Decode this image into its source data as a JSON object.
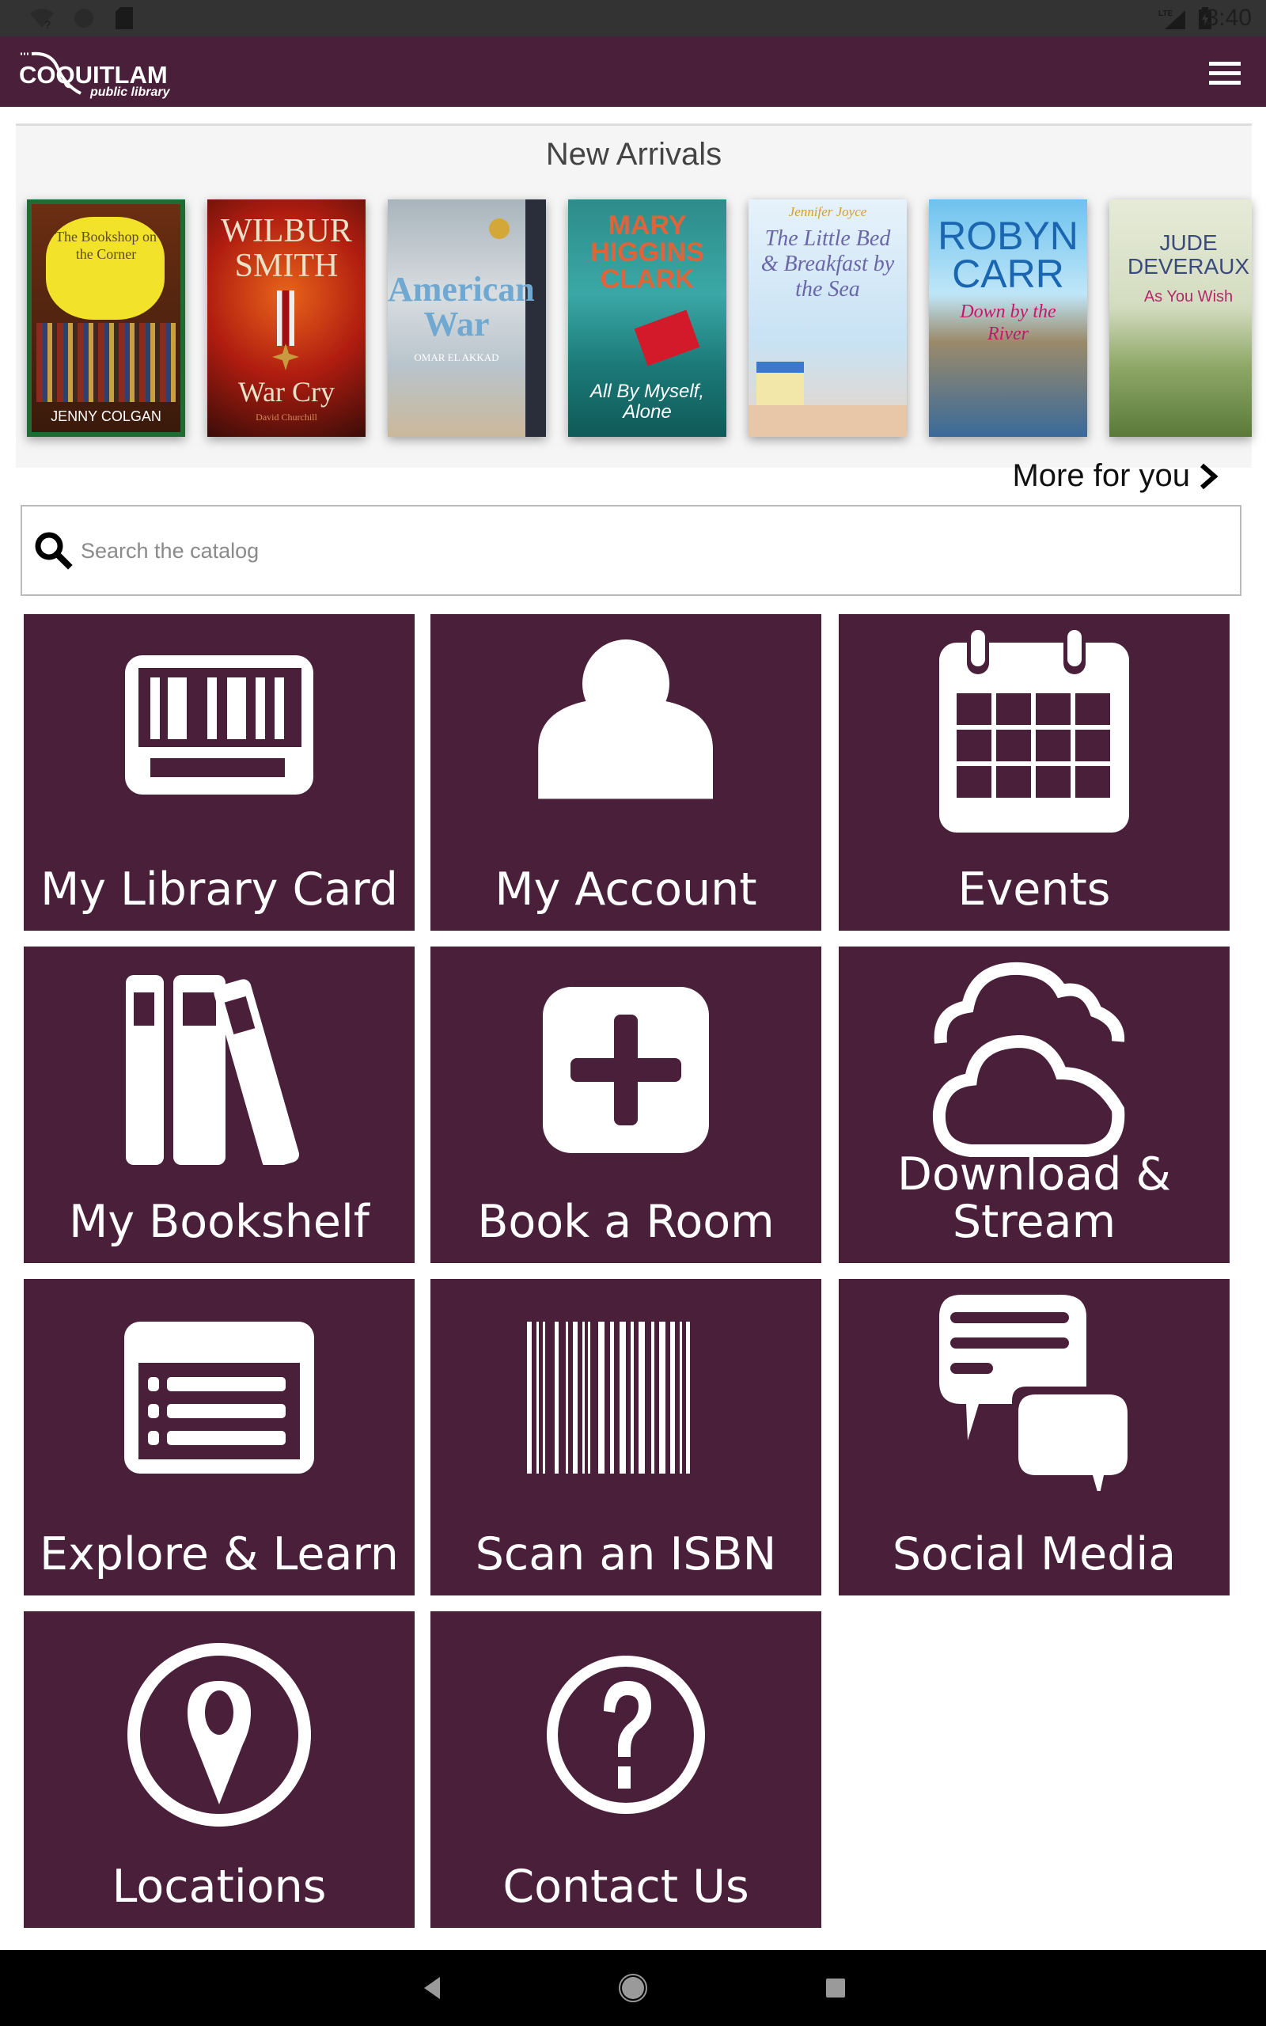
{
  "status_bar": {
    "time": "3:40",
    "icons": [
      "wifi-unknown-icon",
      "data-saver-icon",
      "sd-card-icon",
      "lte-signal-icon",
      "battery-charging-icon"
    ]
  },
  "header": {
    "logo_main": "COQUITLAM",
    "logo_sub": "public library",
    "menu_icon": "hamburger-menu-icon",
    "brand_color": "#4a1f3a"
  },
  "arrivals": {
    "title": "New Arrivals",
    "books": [
      {
        "author": "JENNY COLGAN",
        "title": "The Bookshop on the Corner"
      },
      {
        "author": "WILBUR SMITH",
        "title": "War Cry",
        "coauthor": "David Churchill"
      },
      {
        "author": "OMAR EL AKKAD",
        "title": "American War"
      },
      {
        "author": "MARY HIGGINS CLARK",
        "title": "All By Myself, Alone"
      },
      {
        "author": "Jennifer Joyce",
        "title": "The Little Bed & Breakfast by the Sea"
      },
      {
        "author": "ROBYN CARR",
        "title": "Down by the River"
      },
      {
        "author": "JUDE DEVERAUX",
        "title": "As You Wish"
      }
    ],
    "more_label": "More for you"
  },
  "search": {
    "placeholder": "Search the catalog",
    "value": ""
  },
  "tiles": [
    {
      "label": "My Library Card",
      "icon": "library-card-icon"
    },
    {
      "label": "My Account",
      "icon": "user-icon"
    },
    {
      "label": "Events",
      "icon": "calendar-icon"
    },
    {
      "label": "My Bookshelf",
      "icon": "bookshelf-icon"
    },
    {
      "label": "Book a Room",
      "icon": "plus-square-icon"
    },
    {
      "label": "Download & Stream",
      "icon": "cloud-icon"
    },
    {
      "label": "Explore & Learn",
      "icon": "list-card-icon"
    },
    {
      "label": "Scan an ISBN",
      "icon": "barcode-icon"
    },
    {
      "label": "Social Media",
      "icon": "chat-bubbles-icon"
    },
    {
      "label": "Locations",
      "icon": "map-pin-icon"
    },
    {
      "label": "Contact Us",
      "icon": "question-circle-icon"
    }
  ],
  "nav_bar": {
    "buttons": [
      "back",
      "home",
      "recents"
    ]
  }
}
